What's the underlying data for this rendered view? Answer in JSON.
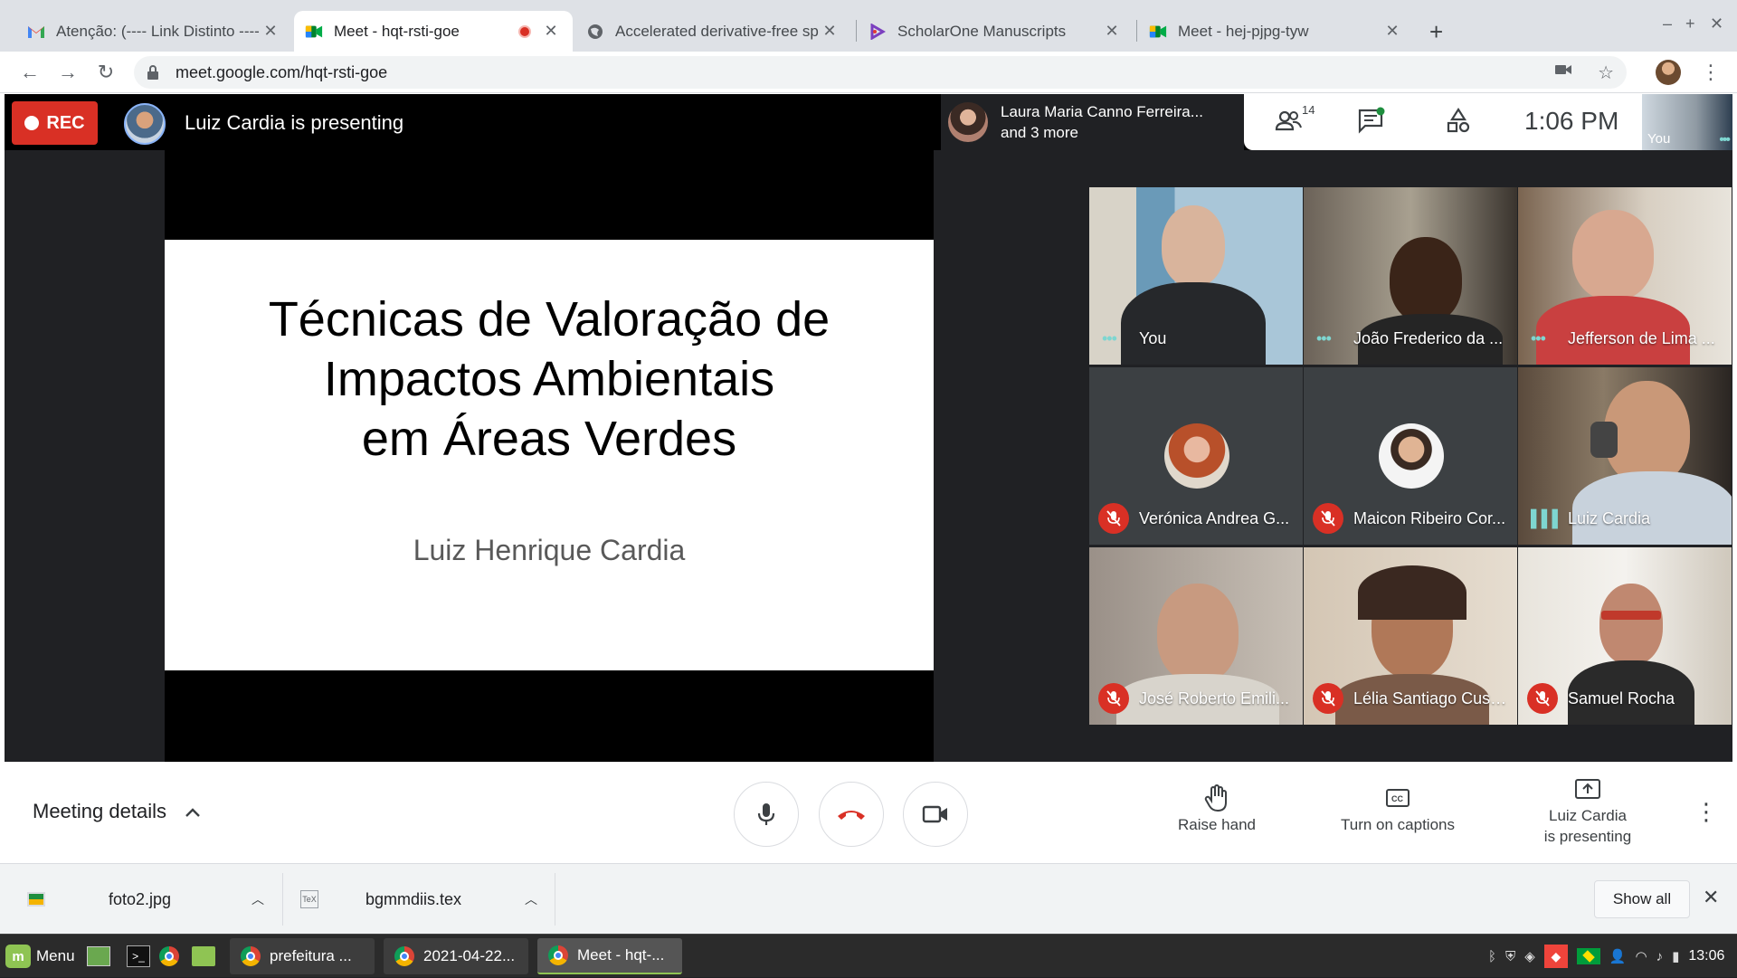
{
  "tabs": [
    {
      "title": "Atenção: (---- Link Distinto ----)",
      "icon": "gmail-icon"
    },
    {
      "title": "Meet - hqt-rsti-goe",
      "icon": "meet-icon",
      "active": true,
      "recording": true
    },
    {
      "title": "Accelerated derivative-free sp",
      "icon": "globe-icon"
    },
    {
      "title": "ScholarOne Manuscripts",
      "icon": "scholarone-icon"
    },
    {
      "title": "Meet - hej-pjpg-tyw",
      "icon": "meet-icon"
    }
  ],
  "address_bar": {
    "url": "meet.google.com/hqt-rsti-goe"
  },
  "meet": {
    "rec_label": "REC",
    "presenting_text": "Luiz Cardia is presenting",
    "others_line1": "Laura Maria Canno Ferreira...",
    "others_line2": "and 3 more",
    "participant_count": "14",
    "time": "1:06  PM",
    "self_label": "You"
  },
  "slide": {
    "title_lines": [
      "Técnicas de Valoração de",
      "Impactos Ambientais",
      "em Áreas Verdes"
    ],
    "author": "Luiz Henrique Cardia"
  },
  "participants": [
    {
      "name": "You",
      "state": "speaking"
    },
    {
      "name": "João Frederico da ...",
      "state": "speaking"
    },
    {
      "name": "Jefferson de Lima ...",
      "state": "speaking"
    },
    {
      "name": "Verónica Andrea G...",
      "state": "muted"
    },
    {
      "name": "Maicon Ribeiro Cor...",
      "state": "muted"
    },
    {
      "name": "Luiz Cardia",
      "state": "talking"
    },
    {
      "name": "José Roberto Emili...",
      "state": "muted"
    },
    {
      "name": "Lélia Santiago Cust...",
      "state": "muted"
    },
    {
      "name": "Samuel Rocha",
      "state": "muted"
    }
  ],
  "controls": {
    "meeting_details": "Meeting details",
    "raise_hand": "Raise hand",
    "captions": "Turn on captions",
    "present_line1": "Luiz Cardia",
    "present_line2": "is presenting"
  },
  "downloads": {
    "items": [
      "foto2.jpg",
      "bgmmdiis.tex"
    ],
    "show_all": "Show all"
  },
  "taskbar": {
    "menu": "Menu",
    "windows": [
      "prefeitura ...",
      "2021-04-22...",
      "Meet - hqt-..."
    ],
    "clock": "13:06"
  },
  "colors": {
    "rec_red": "#d93025",
    "speaking_teal": "#7ed6d1",
    "meet_dark": "#202124"
  }
}
